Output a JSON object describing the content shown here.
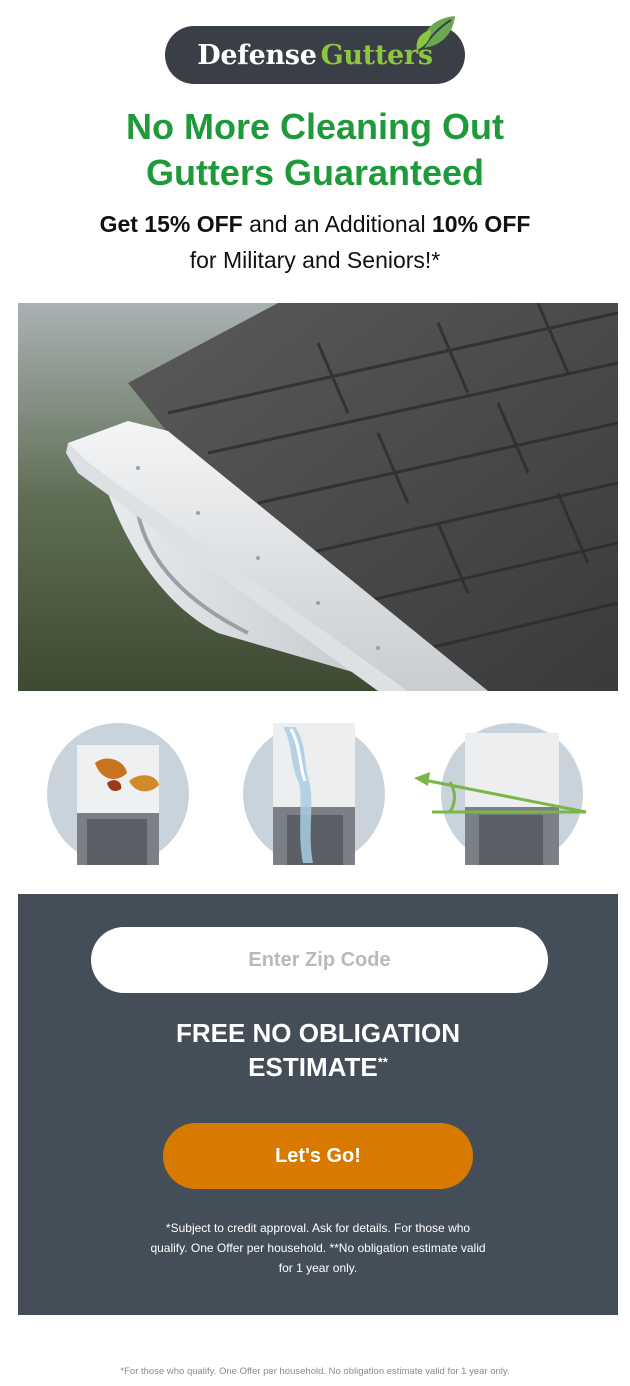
{
  "logo": {
    "word1": "Defense",
    "word2": "Gutters"
  },
  "headline": {
    "line1": "No More Cleaning Out",
    "line2": "Gutters Guaranteed"
  },
  "subhead": {
    "get": "Get",
    "offer1": "15% OFF",
    "middle": "and an Additional",
    "offer2": "10% OFF",
    "line2": "for Military and Seniors!*"
  },
  "features": [
    {
      "icon": "falling-leaves-icon"
    },
    {
      "icon": "water-flow-icon"
    },
    {
      "icon": "pitch-angle-icon"
    }
  ],
  "form": {
    "zip_placeholder": "Enter Zip Code",
    "estimate_line1": "FREE NO OBLIGATION",
    "estimate_line2": "ESTIMATE",
    "estimate_sup": "**",
    "cta_label": "Let's Go!",
    "disclaimer": "*Subject to credit approval. Ask for details. For those who qualify. One Offer per household. **No obligation estimate valid for 1 year only."
  },
  "footer": {
    "text": "*For those who qualify. One Offer per household. No obligation estimate valid for 1 year only."
  },
  "colors": {
    "brand_green": "#1f9a3a",
    "logo_green": "#8cc63f",
    "panel": "#444e59",
    "cta": "#d97a00"
  }
}
